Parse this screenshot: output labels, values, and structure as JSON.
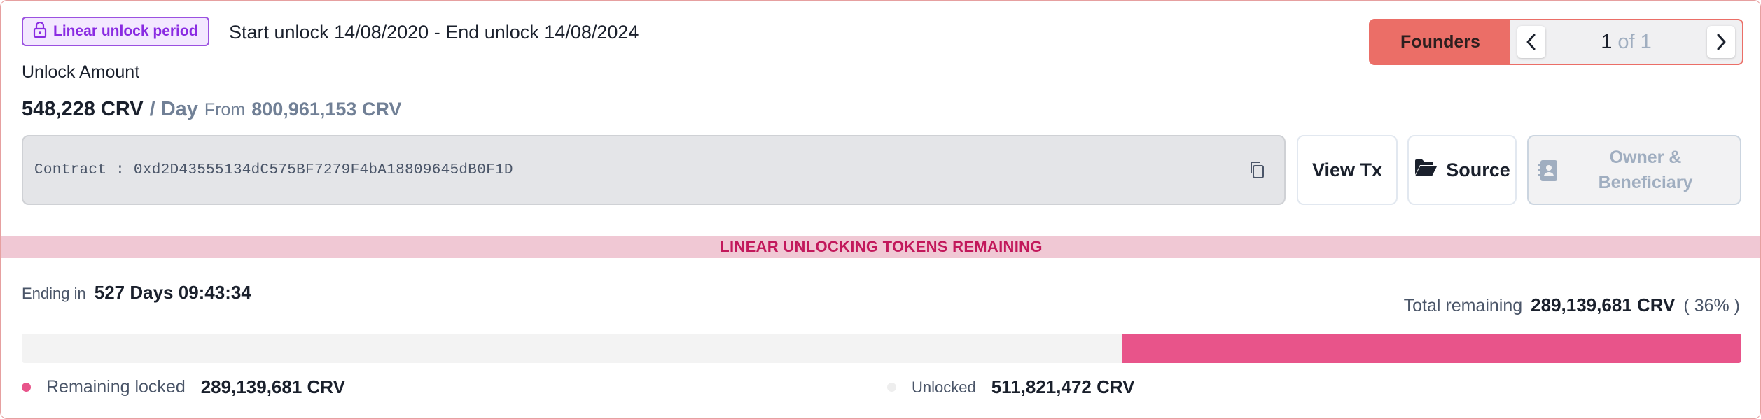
{
  "header": {
    "badge_label": "Linear unlock period",
    "period_text": "Start unlock 14/08/2020 - End unlock 14/08/2024",
    "unlock_amount_label": "Unlock Amount",
    "rate_amount": "548,228 CRV",
    "rate_unit": "/ Day",
    "from_label": "From",
    "total_allocation": "800,961,153 CRV"
  },
  "selector": {
    "group_label": "Founders",
    "current_page": "1",
    "of_text": "of 1"
  },
  "contract": {
    "text": "Contract : 0xd2D43555134dC575BF7279F4bA18809645dB0F1D"
  },
  "actions": {
    "view_tx": "View Tx",
    "source": "Source",
    "owner_line1": "Owner &",
    "owner_line2": "Beneficiary"
  },
  "banner": "LINEAR UNLOCKING TOKENS REMAINING",
  "status": {
    "ending_label": "Ending in",
    "countdown": "527 Days 09:43:34",
    "total_remaining_label": "Total remaining",
    "total_remaining_value": "289,139,681 CRV",
    "total_remaining_pct": "( 36% )"
  },
  "progress": {
    "remaining_fraction": 0.36
  },
  "legend": {
    "remaining_label": "Remaining locked",
    "remaining_value": "289,139,681 CRV",
    "unlocked_label": "Unlocked",
    "unlocked_value": "511,821,472 CRV"
  },
  "colors": {
    "accent_pink": "#e8548a",
    "founders_bg": "#eb6e67",
    "badge_purple": "#8a2be2",
    "banner_bg": "#f0c8d4",
    "banner_text": "#c2185b"
  }
}
